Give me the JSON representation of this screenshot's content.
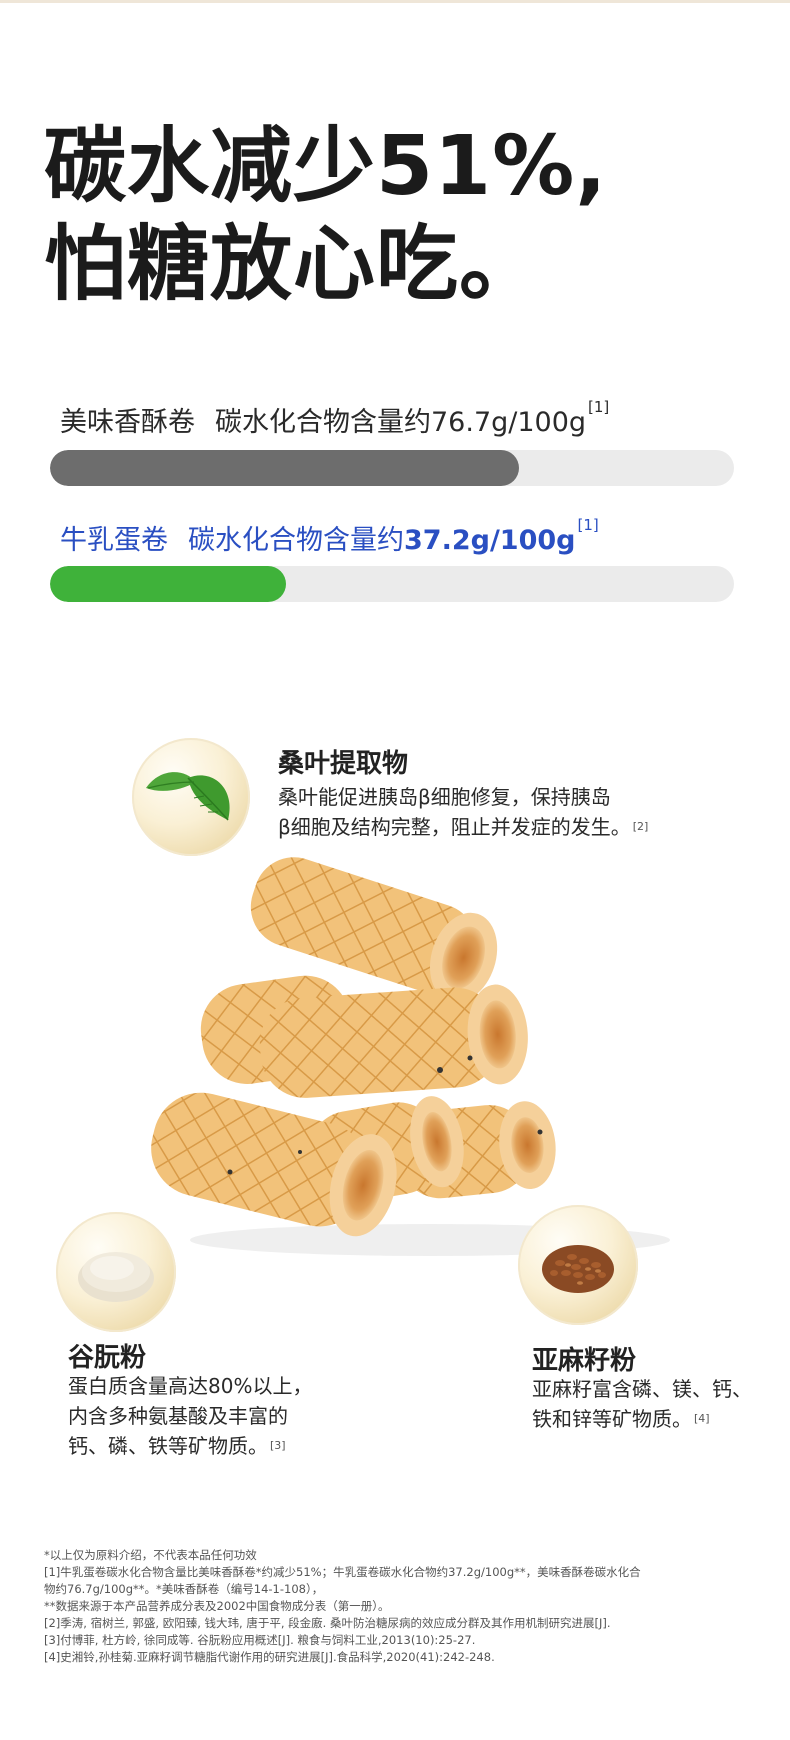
{
  "headline": {
    "line1": "碳水减少51%,",
    "line2": "怕糖放心吃。"
  },
  "comparison": [
    {
      "product": "美味香酥卷",
      "metric_prefix": "碳水化合物含量约",
      "metric_value": "76.7g/100g",
      "ref": "[1]",
      "fill_fraction": 0.685,
      "color": "#6d6d6d"
    },
    {
      "product": "牛乳蛋卷",
      "metric_prefix": "碳水化合物含量约",
      "metric_value": "37.2g/100g",
      "ref": "[1]",
      "fill_fraction": 0.345,
      "color": "#3fb23a"
    }
  ],
  "ingredients": [
    {
      "title": "桑叶提取物",
      "lines": [
        "桑叶能促进胰岛β细胞修复，保持胰岛",
        "β细胞及结构完整，阻止并发症的发生。"
      ],
      "ref": "[2]",
      "icon": "mulberry-leaf-icon"
    },
    {
      "title": "谷朊粉",
      "lines": [
        "蛋白质含量高达80%以上，",
        "内含多种氨基酸及丰富的",
        "钙、磷、铁等矿物质。"
      ],
      "ref": "[3]",
      "icon": "wheat-gluten-powder-icon"
    },
    {
      "title": "亚麻籽粉",
      "lines": [
        "亚麻籽富含磷、镁、钙、",
        "铁和锌等矿物质。"
      ],
      "ref": "[4]",
      "icon": "flaxseed-icon"
    }
  ],
  "footnotes": [
    "*以上仅为原料介绍，不代表本品任何功效",
    "[1]牛乳蛋卷碳水化合物含量比美味香酥卷*约减少51%；牛乳蛋卷碳水化合物约37.2g/100g**，美味香酥卷碳水化合",
    "物约76.7g/100g**。*美味香酥卷（编号14-1-108），",
    "**数据来源于本产品营养成分表及2002中国食物成分表（第一册）。",
    "[2]季涛, 宿树兰, 郭盛, 欧阳臻, 钱大玮, 唐于平, 段金廒. 桑叶防治糖尿病的效应成分群及其作用机制研究进展[J].",
    "[3]付博菲, 杜方岭, 徐同成等. 谷朊粉应用概述[J]. 粮食与饲料工业,2013(10):25-27.",
    "[4]史湘铃,孙桂菊.亚麻籽调节糖脂代谢作用的研究进展[J].食品科学,2020(41):242-248."
  ]
}
